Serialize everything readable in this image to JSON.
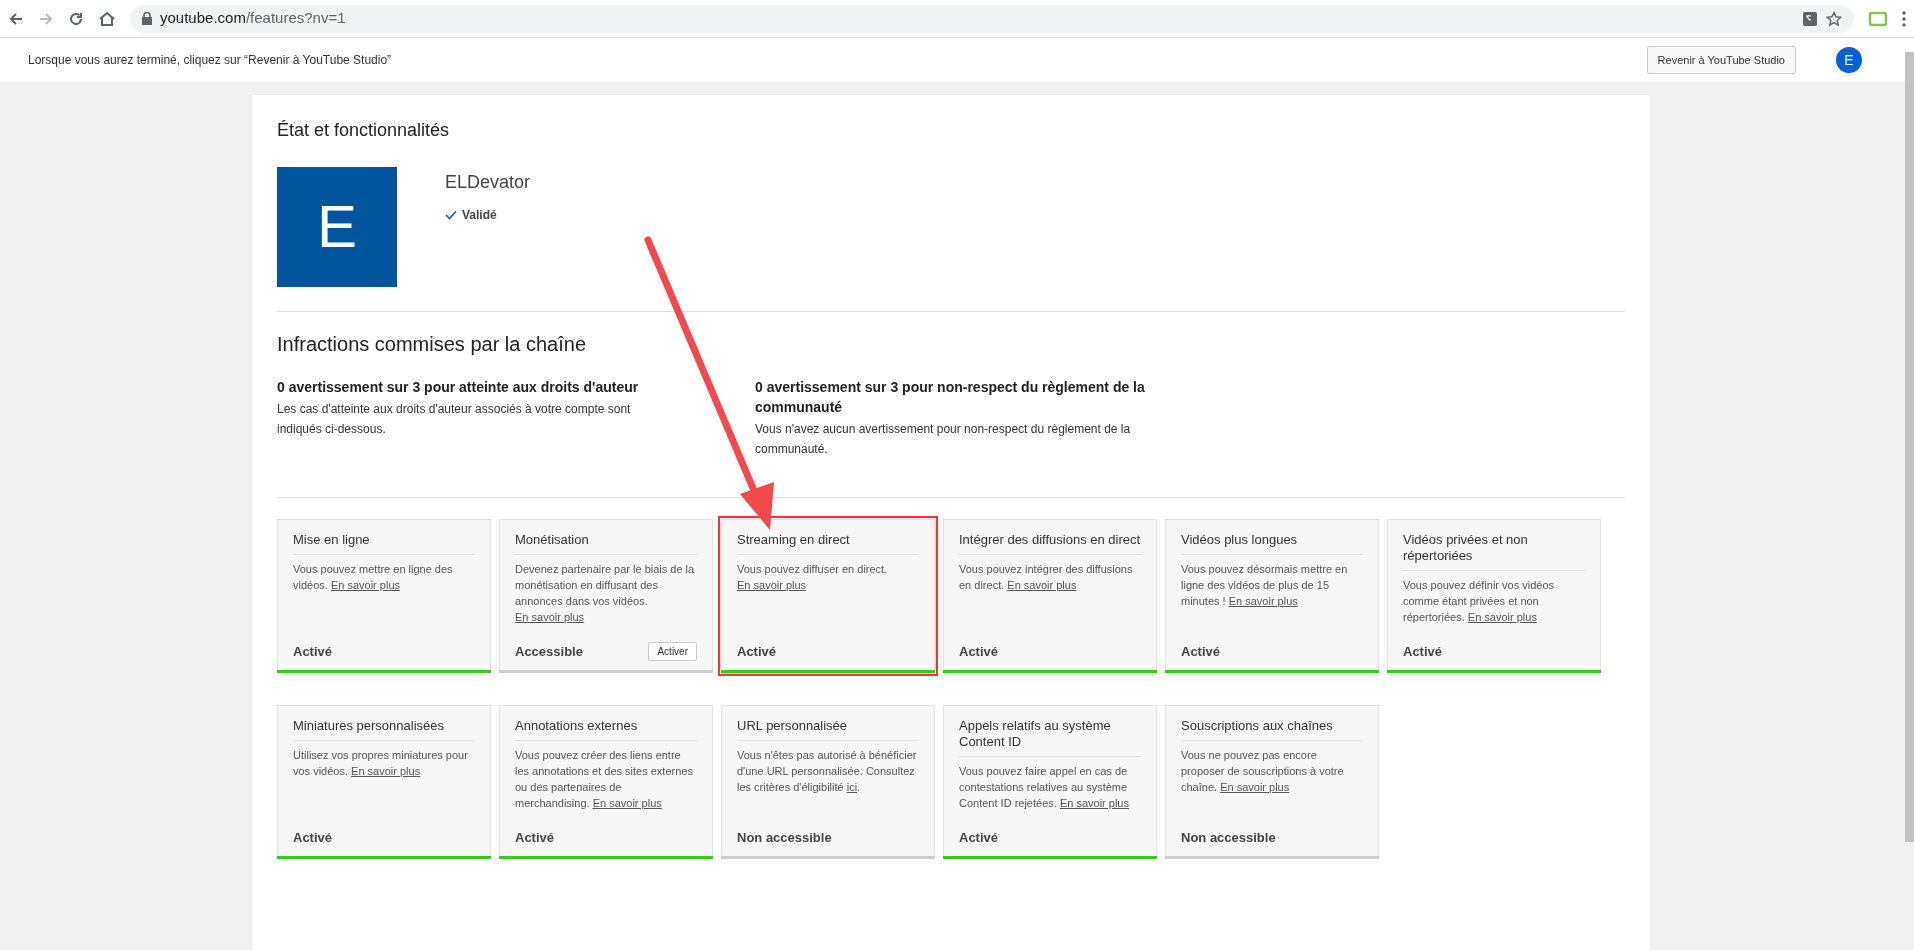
{
  "browser": {
    "url_host": "youtube.com",
    "url_path": "/features?nv=1"
  },
  "notice": {
    "text": "Lorsque vous aurez terminé, cliquez sur “Revenir à YouTube Studio”",
    "button": "Revenir à YouTube Studio",
    "avatar": "E"
  },
  "page": {
    "title": "État et fonctionnalités",
    "channel": {
      "initial": "E",
      "name": "ELDevator",
      "status": "Validé"
    }
  },
  "infractions": {
    "title": "Infractions commises par la chaîne",
    "items": [
      {
        "heading": "0 avertissement sur 3 pour atteinte aux droits d'auteur",
        "text": "Les cas d'atteinte aux droits d'auteur associés à votre compte sont indiqués ci-dessous."
      },
      {
        "heading": "0 avertissement sur 3 pour non-respect du règlement de la communauté",
        "text": "Vous n'avez aucun avertissement pour non-respect du règlement de la communauté."
      }
    ]
  },
  "features": [
    {
      "title": "Mise en ligne",
      "text": "Vous pouvez mettre en ligne des vidéos. ",
      "link": "En savoir plus",
      "status": "Activé",
      "enabled": true,
      "highlighted": false
    },
    {
      "title": "Monétisation",
      "text": "Devenez partenaire par le biais de la monétisation en diffusant des annonces dans vos vidéos. ",
      "link": "En savoir plus",
      "status": "Accessible",
      "enabled": false,
      "highlighted": false,
      "button": "Activer"
    },
    {
      "title": "Streaming en direct",
      "text": "Vous pouvez diffuser en direct. ",
      "link": "En savoir plus",
      "status": "Activé",
      "enabled": true,
      "highlighted": true
    },
    {
      "title": "Intégrer des diffusions en direct",
      "text": "Vous pouvez intégrer des diffusions en direct. ",
      "link": "En savoir plus",
      "status": "Activé",
      "enabled": true,
      "highlighted": false
    },
    {
      "title": "Vidéos plus longues",
      "text": "Vous pouvez désormais mettre en ligne des vidéos de plus de 15 minutes ! ",
      "link": "En savoir plus",
      "status": "Activé",
      "enabled": true,
      "highlighted": false
    },
    {
      "title": "Vidéos privées et non répertoriées",
      "text": "Vous pouvez définir vos vidéos comme étant privées et non répertoriées. ",
      "link": "En savoir plus",
      "status": "Activé",
      "enabled": true,
      "highlighted": false
    },
    {
      "title": "Miniatures personnalisées",
      "text": "Utilisez vos propres miniatures pour vos vidéos. ",
      "link": "En savoir plus",
      "status": "Activé",
      "enabled": true,
      "highlighted": false
    },
    {
      "title": "Annotations externes",
      "text": "Vous pouvez créer des liens entre les annotations et des sites externes ou des partenaires de merchandising. ",
      "link": "En savoir plus",
      "status": "Activé",
      "enabled": true,
      "highlighted": false
    },
    {
      "title": "URL personnalisée",
      "text": "Vous n'êtes pas autorisé à bénéficier d'une URL personnalisée. Consultez les critères d'éligibilité ",
      "link": "ici",
      "after": ".",
      "status": "Non accessible",
      "enabled": false,
      "highlighted": false
    },
    {
      "title": "Appels relatifs au système Content ID",
      "text": "Vous pouvez faire appel en cas de contestations relatives au système Content ID rejetées. ",
      "link": "En savoir plus",
      "status": "Activé",
      "enabled": true,
      "highlighted": false
    },
    {
      "title": "Souscriptions aux chaînes",
      "text": "Vous ne pouvez pas encore proposer de souscriptions à votre chaîne. ",
      "link": "En savoir plus",
      "status": "Non accessible",
      "enabled": false,
      "highlighted": false
    }
  ]
}
